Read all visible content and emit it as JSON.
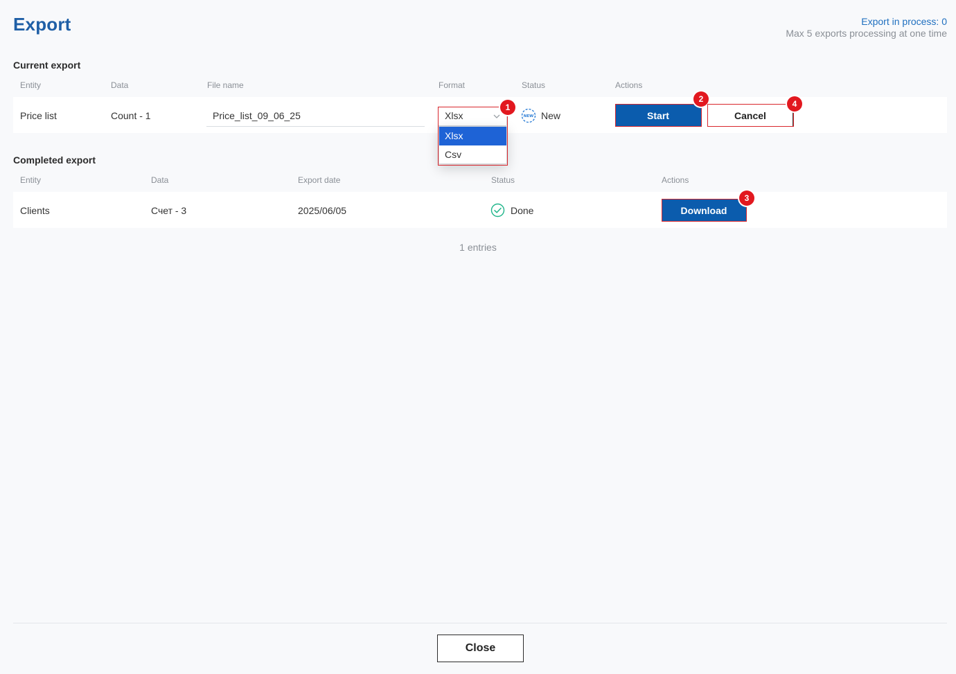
{
  "header": {
    "title": "Export",
    "process_count": "Export in process: 0",
    "process_limit": "Max 5 exports processing at one time"
  },
  "current_export": {
    "section_title": "Current export",
    "columns": {
      "entity": "Entity",
      "data": "Data",
      "file_name": "File name",
      "format": "Format",
      "status": "Status",
      "actions": "Actions"
    },
    "row": {
      "entity": "Price list",
      "data": "Count - 1",
      "file_name": "Price_list_09_06_25",
      "format": "Xlsx",
      "status": "New",
      "status_icon": "new-badge-icon",
      "start_label": "Start",
      "cancel_label": "Cancel"
    },
    "format_options": [
      "Xlsx",
      "Csv"
    ],
    "selected_format": "Xlsx"
  },
  "completed_export": {
    "section_title": "Completed export",
    "columns": {
      "entity": "Entity",
      "data": "Data",
      "export_date": "Export date",
      "status": "Status",
      "actions": "Actions"
    },
    "rows": [
      {
        "entity": "Clients",
        "data": "Счет - 3",
        "export_date": "2025/06/05",
        "status": "Done",
        "status_icon": "check-circle-icon",
        "download_label": "Download"
      }
    ],
    "entries": "1 entries"
  },
  "annotations": [
    "1",
    "2",
    "3",
    "4"
  ],
  "footer": {
    "close_label": "Close"
  },
  "colors": {
    "brand": "#0b5cad",
    "title": "#1f5fa6",
    "highlight": "#d9262c",
    "done": "#1fb58a",
    "new": "#2f7fd6"
  }
}
